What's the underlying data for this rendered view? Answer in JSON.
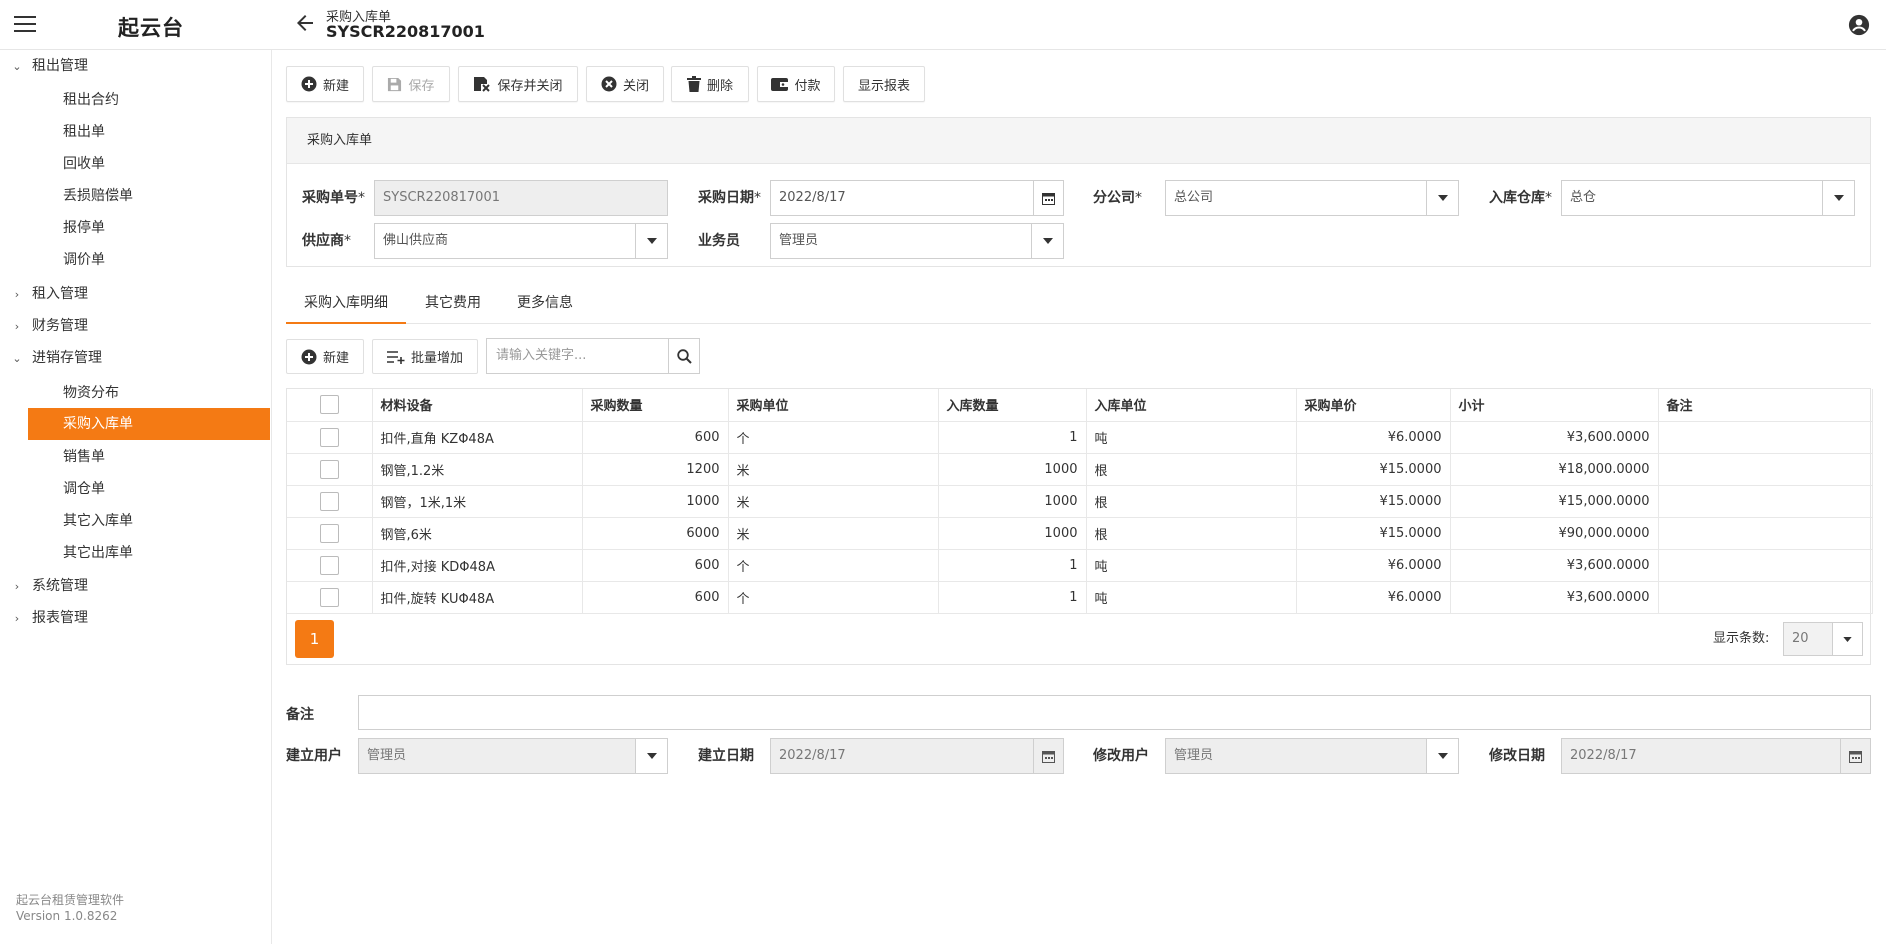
{
  "app": {
    "brand": "起云台"
  },
  "header": {
    "subtitle": "采购入库单",
    "title": "SYSCR220817001"
  },
  "sidebar": {
    "groups": [
      {
        "label": "租出管理",
        "expanded": true,
        "items": [
          "租出合约",
          "租出单",
          "回收单",
          "丢损赔偿单",
          "报停单",
          "调价单"
        ]
      },
      {
        "label": "租入管理",
        "expanded": false,
        "items": []
      },
      {
        "label": "财务管理",
        "expanded": false,
        "items": []
      },
      {
        "label": "进销存管理",
        "expanded": true,
        "items": [
          "物资分布",
          "采购入库单",
          "销售单",
          "调仓单",
          "其它入库单",
          "其它出库单"
        ],
        "active_item": "采购入库单"
      },
      {
        "label": "系统管理",
        "expanded": false,
        "items": []
      },
      {
        "label": "报表管理",
        "expanded": false,
        "items": []
      }
    ],
    "footer": {
      "product": "起云台租赁管理软件",
      "version": "Version 1.0.8262"
    }
  },
  "toolbar": {
    "new": "新建",
    "save": "保存",
    "save_close": "保存并关闭",
    "close": "关闭",
    "delete": "删除",
    "pay": "付款",
    "report": "显示报表"
  },
  "form": {
    "panel_title": "采购入库单",
    "order_no": {
      "label": "采购单号",
      "req": "*",
      "value": "SYSCR220817001"
    },
    "order_date": {
      "label": "采购日期",
      "req": "*",
      "value": "2022/8/17"
    },
    "branch": {
      "label": "分公司",
      "req": "*",
      "value": "总公司"
    },
    "warehouse": {
      "label": "入库仓库",
      "req": "*",
      "value": "总仓"
    },
    "supplier": {
      "label": "供应商",
      "req": "*",
      "value": "佛山供应商"
    },
    "salesman": {
      "label": "业务员",
      "value": "管理员"
    }
  },
  "tabs": [
    "采购入库明细",
    "其它费用",
    "更多信息"
  ],
  "detail_toolbar": {
    "new": "新建",
    "batch_add": "批量增加",
    "search_placeholder": "请输入关键字..."
  },
  "grid": {
    "columns": [
      "材料设备",
      "采购数量",
      "采购单位",
      "入库数量",
      "入库单位",
      "采购单价",
      "小计",
      "备注"
    ],
    "rows": [
      [
        "扣件,直角 KZΦ48A",
        "600",
        "个",
        "1",
        "吨",
        "¥6.0000",
        "¥3,600.0000",
        ""
      ],
      [
        "钢管,1.2米",
        "1200",
        "米",
        "1000",
        "根",
        "¥15.0000",
        "¥18,000.0000",
        ""
      ],
      [
        "钢管，1米,1米",
        "1000",
        "米",
        "1000",
        "根",
        "¥15.0000",
        "¥15,000.0000",
        ""
      ],
      [
        "钢管,6米",
        "6000",
        "米",
        "1000",
        "根",
        "¥15.0000",
        "¥90,000.0000",
        ""
      ],
      [
        "扣件,对接 KDΦ48A",
        "600",
        "个",
        "1",
        "吨",
        "¥6.0000",
        "¥3,600.0000",
        ""
      ],
      [
        "扣件,旋转 KUΦ48A",
        "600",
        "个",
        "1",
        "吨",
        "¥6.0000",
        "¥3,600.0000",
        ""
      ]
    ],
    "current_page": "1",
    "page_size_label": "显示条数:",
    "page_size": "20"
  },
  "footer_form": {
    "remark_label": "备注",
    "remark_value": "",
    "creator": {
      "label": "建立用户",
      "value": "管理员"
    },
    "created_date": {
      "label": "建立日期",
      "value": "2022/8/17"
    },
    "modifier": {
      "label": "修改用户",
      "value": "管理员"
    },
    "modified_date": {
      "label": "修改日期",
      "value": "2022/8/17"
    }
  },
  "colors": {
    "accent": "#f47a14",
    "border": "#e4e4e4",
    "readonly_bg": "#eeeeee"
  }
}
